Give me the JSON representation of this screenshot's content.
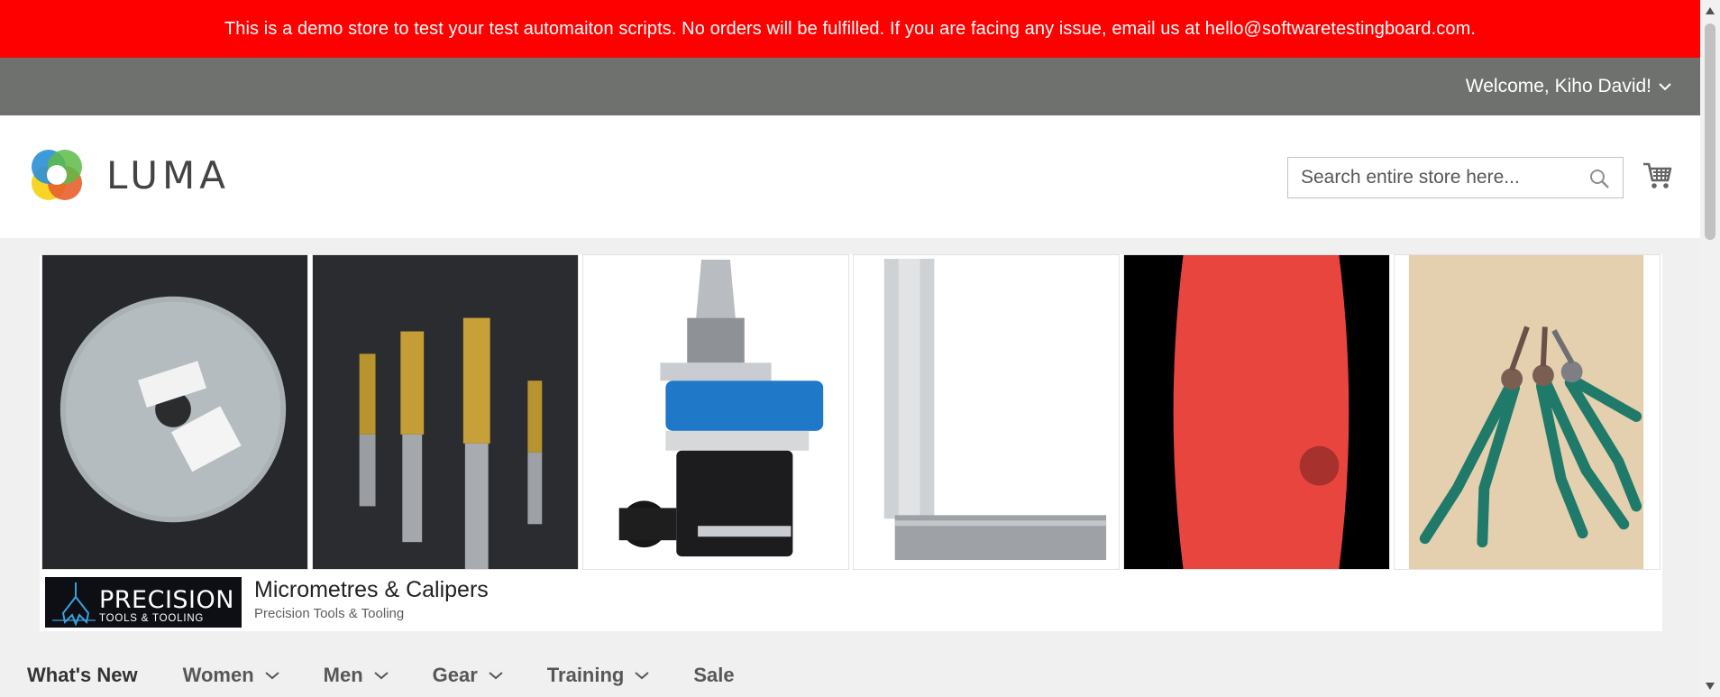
{
  "demo_notice": {
    "text": "This is a demo store to test your test automaiton scripts. No orders will be fulfilled. If you are facing any issue, email us at hello@softwaretestingboard.com."
  },
  "header": {
    "welcome_text": "Welcome, Kiho David!"
  },
  "logo": {
    "text": "LUMA"
  },
  "search": {
    "placeholder": "Search entire store here..."
  },
  "icons": {
    "search": "search-icon",
    "cart": "cart-icon",
    "welcome_dropdown": "chevron-down-icon",
    "ad_choices": "info-icon",
    "ad_menu": "more-vertical-icon"
  },
  "ad": {
    "tiles": [
      {
        "name": "grinding-wheel"
      },
      {
        "name": "thread-taps"
      },
      {
        "name": "angle-head"
      },
      {
        "name": "engineers-square"
      },
      {
        "name": "sanding-belt"
      },
      {
        "name": "circlip-pliers"
      }
    ],
    "brand_title": "PRECISION",
    "brand_subtitle": "TOOLS & TOOLING",
    "headline": "Micrometres & Calipers",
    "advertiser": "Precision Tools & Tooling"
  },
  "nav": {
    "items": [
      {
        "label": "What's New",
        "has_dropdown": false
      },
      {
        "label": "Women",
        "has_dropdown": true
      },
      {
        "label": "Men",
        "has_dropdown": true
      },
      {
        "label": "Gear",
        "has_dropdown": true
      },
      {
        "label": "Training",
        "has_dropdown": true
      },
      {
        "label": "Sale",
        "has_dropdown": false
      }
    ]
  },
  "colors": {
    "notice_bg": "#ff0000",
    "panel_bg": "#6e716e",
    "page_bg": "#f0f0f0",
    "ad_choices_blue": "#1a73e8"
  }
}
